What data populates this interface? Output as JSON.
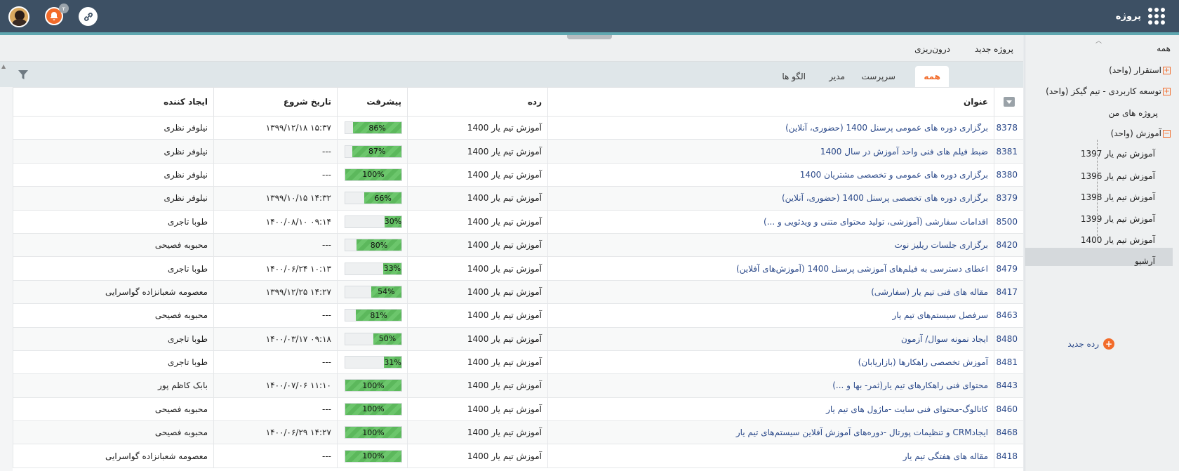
{
  "header": {
    "brand": "پروژه",
    "notifications_count": "۲"
  },
  "actions": {
    "new_project": "پروژه جدید",
    "import": "درون‌ریزی"
  },
  "tabs": [
    {
      "label": "همه",
      "active": true
    },
    {
      "label": "سرپرست",
      "active": false
    },
    {
      "label": "مدیر",
      "active": false
    },
    {
      "label": "الگو ها",
      "active": false
    }
  ],
  "table": {
    "columns": [
      "عنوان",
      "رده",
      "پیشرفت",
      "تاریخ شروع",
      "ایجاد کننده"
    ],
    "rows": [
      {
        "id": "8378",
        "title": "برگزاری دوره های عمومی پرسنل 1400 (حضوری، آنلاین)",
        "category": "آموزش تیم یار 1400",
        "progress": 86,
        "progress_label": "86%",
        "start": "۱۳۹۹/۱۲/۱۸ ۱۵:۳۷",
        "creator": "نیلوفر نظری"
      },
      {
        "id": "8381",
        "title": "ضبط فیلم های فنی واحد آموزش در سال 1400",
        "category": "آموزش تیم یار 1400",
        "progress": 87,
        "progress_label": "87%",
        "start": "---",
        "creator": "نیلوفر نظری"
      },
      {
        "id": "8380",
        "title": "برگزاری دوره های عمومی و تخصصی مشتریان 1400",
        "category": "آموزش تیم یار 1400",
        "progress": 100,
        "progress_label": "100%",
        "start": "---",
        "creator": "نیلوفر نظری"
      },
      {
        "id": "8379",
        "title": "برگزاری دوره های تخصصی پرسنل 1400 (حضوری، آنلاین)",
        "category": "آموزش تیم یار 1400",
        "progress": 66,
        "progress_label": "66%",
        "start": "۱۳۹۹/۱۰/۱۵ ۱۴:۳۲",
        "creator": "نیلوفر نظری"
      },
      {
        "id": "8500",
        "title": "اقدامات سفارشی (آموزشی، تولید محتوای متنی و ویدئویی و ...)",
        "category": "آموزش تیم یار 1400",
        "progress": 30,
        "progress_label": "30%",
        "start": "۱۴۰۰/۰۸/۱۰ ۰۹:۱۴",
        "creator": "طوبا تاجری"
      },
      {
        "id": "8420",
        "title": "برگزاری جلسات ریلیز نوت",
        "category": "آموزش تیم یار 1400",
        "progress": 80,
        "progress_label": "80%",
        "start": "---",
        "creator": "محبوبه فصیحی"
      },
      {
        "id": "8479",
        "title": "اعطای دسترسی به فیلم‌های آموزشی پرسنل 1400 (آموزش‌های آفلاین)",
        "category": "آموزش تیم یار 1400",
        "progress": 33,
        "progress_label": "33%",
        "start": "۱۴۰۰/۰۶/۲۴ ۱۰:۱۳",
        "creator": "طوبا تاجری"
      },
      {
        "id": "8417",
        "title": "مقاله های فنی تیم یار (سفارشی)",
        "category": "آموزش تیم یار 1400",
        "progress": 54,
        "progress_label": "54%",
        "start": "۱۳۹۹/۱۲/۲۵ ۱۴:۲۷",
        "creator": "معصومه شعبانزاده گواسرایی"
      },
      {
        "id": "8463",
        "title": "سرفصل سیستم‌های تیم یار",
        "category": "آموزش تیم یار 1400",
        "progress": 81,
        "progress_label": "81%",
        "start": "---",
        "creator": "محبوبه فصیحی"
      },
      {
        "id": "8480",
        "title": "ایجاد نمونه سوال/ آزمون",
        "category": "آموزش تیم یار 1400",
        "progress": 50,
        "progress_label": "50%",
        "start": "۱۴۰۰/۰۳/۱۷ ۰۹:۱۸",
        "creator": "طوبا تاجری"
      },
      {
        "id": "8481",
        "title": "آموزش تخصصی راهکارها (بازاریابان)",
        "category": "آموزش تیم یار 1400",
        "progress": 31,
        "progress_label": "31%",
        "start": "---",
        "creator": "طوبا تاجری"
      },
      {
        "id": "8443",
        "title": "محتوای فنی راهکارهای تیم یار(ثمر- بها و ...)",
        "category": "آموزش تیم یار 1400",
        "progress": 100,
        "progress_label": "100%",
        "start": "۱۴۰۰/۰۷/۰۶ ۱۱:۱۰",
        "creator": "بابک کاظم پور"
      },
      {
        "id": "8460",
        "title": "کاتالوگ-محتوای فنی سایت -ماژول های تیم یار",
        "category": "آموزش تیم یار 1400",
        "progress": 100,
        "progress_label": "100%",
        "start": "---",
        "creator": "محبوبه فصیحی"
      },
      {
        "id": "8468",
        "title": "ایجادCRM و تنظیمات پورتال -دوره‌های آموزش آفلاین سیستم‌های تیم یار",
        "category": "آموزش تیم یار 1400",
        "progress": 100,
        "progress_label": "100%",
        "start": "۱۴۰۰/۰۶/۲۹ ۱۴:۲۷",
        "creator": "محبوبه فصیحی"
      },
      {
        "id": "8418",
        "title": "مقاله های هفتگی تیم یار",
        "category": "آموزش تیم یار 1400",
        "progress": 100,
        "progress_label": "100%",
        "start": "---",
        "creator": "معصومه شعبانزاده گواسرایی"
      }
    ]
  },
  "sidebar": {
    "all": "همه",
    "items": [
      {
        "label": "استقرار (واحد)",
        "expand": "+"
      },
      {
        "label": "توسعه کاربردی - تیم گیکز (واحد)",
        "expand": "+"
      },
      {
        "label": "پروژه های من",
        "expand": ""
      },
      {
        "label": "آموزش (واحد)",
        "expand": "−"
      }
    ],
    "children": [
      "آموزش تیم یار 1397",
      "آموزش تیم یار 1396",
      "آموزش تیم یار 1398",
      "آموزش تیم یار 1399",
      "آموزش تیم یار 1400"
    ],
    "archive": "آرشیو",
    "new_category": "رده جدید"
  },
  "colors": {
    "topbar": "#3d5064",
    "accent": "#f26b2a",
    "progress": "#5cb85c",
    "link": "#2c4a8a"
  }
}
